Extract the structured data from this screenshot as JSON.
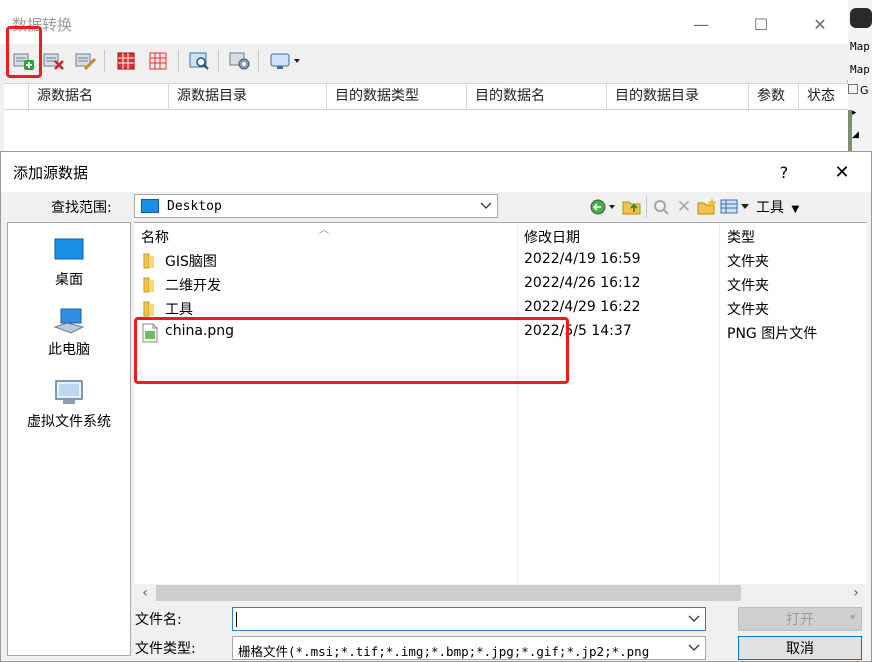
{
  "bg_window": {
    "title": "数据转换",
    "columns": [
      "源数据名",
      "源数据目录",
      "目的数据类型",
      "目的数据名",
      "目的数据目录",
      "参数",
      "状态"
    ]
  },
  "side_app": {
    "items": [
      "Map",
      "Map",
      "G"
    ]
  },
  "dialog": {
    "title": "添加源数据",
    "help": "?",
    "close": "✕",
    "look_in_label": "查找范围:",
    "look_in_value": "Desktop",
    "tools_label": "工具",
    "places": [
      {
        "label": "桌面",
        "icon": "desktop-icon"
      },
      {
        "label": "此电脑",
        "icon": "computer-icon"
      },
      {
        "label": "虚拟文件系统",
        "icon": "virtual-fs-icon"
      }
    ],
    "list_headers": {
      "name": "名称",
      "modified": "修改日期",
      "type": "类型"
    },
    "files": [
      {
        "name": "GIS脑图",
        "modified": "2022/4/19 16:59",
        "type": "文件夹",
        "icon": "folder-icon"
      },
      {
        "name": "二维开发",
        "modified": "2022/4/26 16:12",
        "type": "文件夹",
        "icon": "folder-icon"
      },
      {
        "name": "工具",
        "modified": "2022/4/29 16:22",
        "type": "文件夹",
        "icon": "folder-icon"
      },
      {
        "name": "china.png",
        "modified": "2022/5/5 14:37",
        "type": "PNG 图片文件",
        "icon": "png-file-icon"
      }
    ],
    "filename_label": "文件名:",
    "filename_value": "",
    "filetype_label": "文件类型:",
    "filetype_value": "栅格文件(*.msi;*.tif;*.img;*.bmp;*.jpg;*.gif;*.jp2;*.png",
    "open_button": "打开",
    "cancel_button": "取消"
  },
  "colors": {
    "highlight": "#ee1c1c",
    "focus": "#0078d7",
    "folder": "#f0c44a"
  }
}
